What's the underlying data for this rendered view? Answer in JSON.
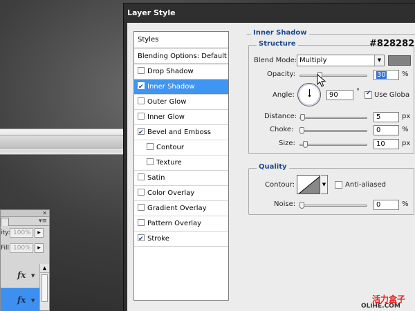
{
  "dialog": {
    "title": "Layer Style"
  },
  "styles": {
    "header": "Styles",
    "blending": "Blending Options: Default",
    "items": [
      {
        "label": "Drop Shadow",
        "checked": false,
        "active": false,
        "sub": false
      },
      {
        "label": "Inner Shadow",
        "checked": true,
        "active": true,
        "sub": false
      },
      {
        "label": "Outer Glow",
        "checked": false,
        "active": false,
        "sub": false
      },
      {
        "label": "Inner Glow",
        "checked": false,
        "active": false,
        "sub": false
      },
      {
        "label": "Bevel and Emboss",
        "checked": true,
        "active": false,
        "sub": false
      },
      {
        "label": "Contour",
        "checked": false,
        "active": false,
        "sub": true
      },
      {
        "label": "Texture",
        "checked": false,
        "active": false,
        "sub": true
      },
      {
        "label": "Satin",
        "checked": false,
        "active": false,
        "sub": false
      },
      {
        "label": "Color Overlay",
        "checked": false,
        "active": false,
        "sub": false
      },
      {
        "label": "Gradient Overlay",
        "checked": false,
        "active": false,
        "sub": false
      },
      {
        "label": "Pattern Overlay",
        "checked": false,
        "active": false,
        "sub": false
      },
      {
        "label": "Stroke",
        "checked": true,
        "active": false,
        "sub": false
      }
    ]
  },
  "inner_shadow": {
    "section_title": "Inner Shadow",
    "structure_title": "Structure",
    "color_hex": "#828282",
    "blend_mode_label": "Blend Mode:",
    "blend_mode_value": "Multiply",
    "opacity_label": "Opacity:",
    "opacity_value": "30",
    "opacity_unit": "%",
    "opacity_fraction": 0.3,
    "angle_label": "Angle:",
    "angle_value": "90",
    "angle_unit": "°",
    "global_light_label": "Use Global Light",
    "global_light_checked": true,
    "distance_label": "Distance:",
    "distance_value": "5",
    "distance_unit": "px",
    "choke_label": "Choke:",
    "choke_value": "0",
    "choke_unit": "%",
    "size_label": "Size:",
    "size_value": "10",
    "size_unit": "px"
  },
  "quality": {
    "title": "Quality",
    "contour_label": "Contour:",
    "anti_aliased_label": "Anti-aliased",
    "anti_aliased_checked": false,
    "noise_label": "Noise:",
    "noise_value": "0",
    "noise_unit": "%"
  },
  "layers_panel": {
    "opacity_label": "ity:",
    "opacity_value": "100%",
    "fill_label": "Fill:",
    "fill_value": "100%",
    "fx_symbol": "fx"
  },
  "watermark": {
    "cn": "活力盒子",
    "en": "OLiHE.COM"
  },
  "colors": {
    "swatch": "#828282",
    "accent": "#3e95f2",
    "section_title": "#1d4a8f"
  }
}
